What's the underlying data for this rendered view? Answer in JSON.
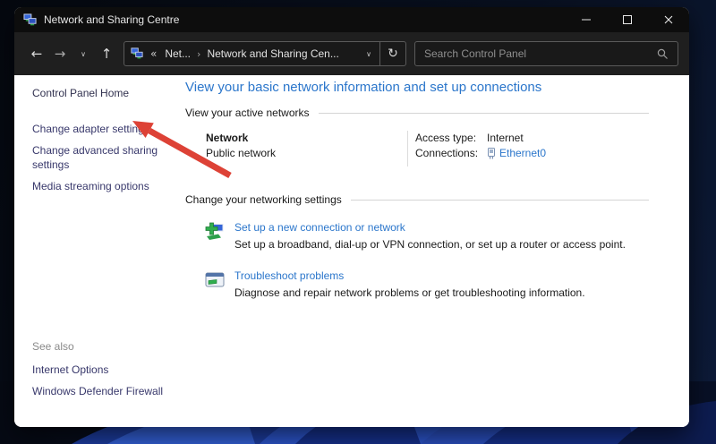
{
  "window": {
    "title": "Network and Sharing Centre"
  },
  "icons": {
    "back": "←",
    "forward": "→",
    "chevron_down": "∨",
    "up": "↑",
    "refresh": "↻",
    "breadcrumb_collapse": "«",
    "breadcrumb_separator": "›",
    "address_chevron": "∨"
  },
  "navbar": {
    "crumb_parent": "Net...",
    "crumb_current": "Network and Sharing Cen...",
    "search_placeholder": "Search Control Panel"
  },
  "sidebar": {
    "home_label": "Control Panel Home",
    "links": [
      {
        "label": "Change adapter settings"
      },
      {
        "label": "Change advanced sharing settings"
      },
      {
        "label": "Media streaming options"
      }
    ],
    "see_also_label": "See also",
    "see_also_links": [
      {
        "label": "Internet Options"
      },
      {
        "label": "Windows Defender Firewall"
      }
    ]
  },
  "main": {
    "heading": "View your basic network information and set up connections",
    "active_networks": {
      "section_label": "View your active networks",
      "network_name": "Network",
      "network_type": "Public network",
      "access_type_label": "Access type:",
      "access_type_value": "Internet",
      "connections_label": "Connections:",
      "connection_name": "Ethernet0"
    },
    "settings": {
      "section_label": "Change your networking settings",
      "tasks": [
        {
          "title": "Set up a new connection or network",
          "desc": "Set up a broadband, dial-up or VPN connection, or set up a router or access point."
        },
        {
          "title": "Troubleshoot problems",
          "desc": "Diagnose and repair network problems or get troubleshooting information."
        }
      ]
    }
  },
  "colors": {
    "heading_blue": "#2b76cb",
    "link_blue": "#2b76cb",
    "sidebar_link": "#38386b",
    "annotation_red": "#dd4236",
    "titlebar_black": "#0d0d0d",
    "toolbar_gray": "#1f1f1f",
    "content_white": "#ffffff"
  }
}
